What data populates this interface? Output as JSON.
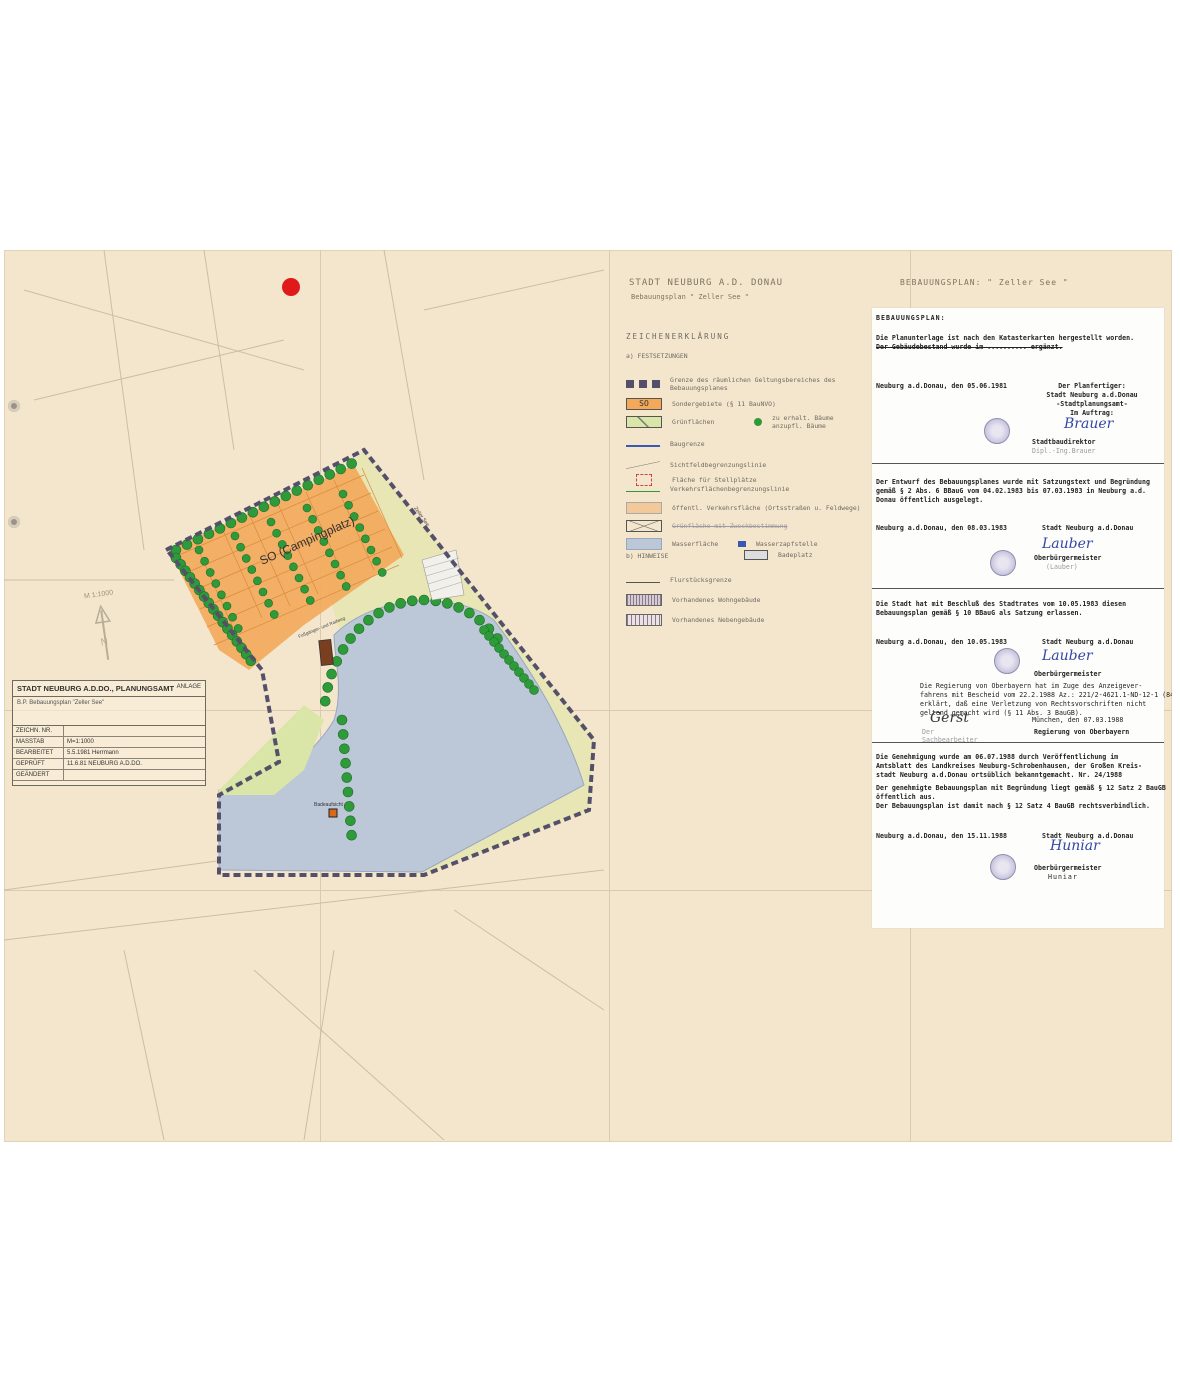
{
  "map": {
    "label_zone": "SO (Campingplatz)",
    "label_road": "Zeller See",
    "label_path": "Fußgänger- und Radweg",
    "label_bath": "Badeaufsicht",
    "label_north": "M 1:1000"
  },
  "title_block": {
    "office": "STADT NEUBURG A.D.DO., PLANUNGSAMT",
    "anlage": "ANLAGE",
    "subject": "B.P. Bebauungsplan \"Zeller See\"",
    "rows": [
      {
        "k": "ZEICHN. NR.",
        "v": ""
      },
      {
        "k": "MASSTAB",
        "v": "M=1:1000"
      },
      {
        "k": "BEARBEITET",
        "v": "5.5.1981 Herrmann"
      },
      {
        "k": "GEPRÜFT",
        "v": "11.6.81   NEUBURG A.D.DO."
      },
      {
        "k": "GEÄNDERT",
        "v": ""
      }
    ]
  },
  "header_left": "STADT   NEUBURG A.D. DONAU",
  "header_sub": "Bebauungsplan  \" Zeller See \"",
  "header_right": "BEBAUUNGSPLAN: \" Zeller See \"",
  "legend": {
    "title": "ZEICHENERKLÄRUNG",
    "section_a": "a)  FESTSETZUNGEN",
    "section_b": "b)  HINWEISE",
    "items": [
      "Grenze des räumlichen Geltungsbereiches des Bebauungsplanes",
      "Sondergebiete (§ 11 BauNVO)",
      "Grünflächen",
      "Baugrenze",
      "Sichtfeldbegrenzungslinie",
      "Fläche für Stellplätze",
      "Verkehrsflächenbegrenzungslinie",
      "öffentl. Verkehrsfläche (Ortsstraßen u. Feldwege)",
      "Wasserfläche",
      "Flurstücksgrenze",
      "Vorhandenes Wohngebäude",
      "Vorhandenes Nebengebäude"
    ],
    "trees_keep": "zu erhalt. Bäume",
    "trees_plant": "anzupfl. Bäume",
    "so_label": "SO",
    "wasserzapfstelle": "Wasserzapfstelle",
    "badeplatz": "Badeplatz"
  },
  "cert": {
    "title": "BEBAUUNGSPLAN:",
    "s1": [
      "Die Planunterlage ist nach den Katasterkarten hergestellt worden.",
      "Der Gebäudebestand wurde im .......... ergänzt."
    ],
    "s1_place": "Neuburg a.d.Donau, den 05.06.1981",
    "s1_right": [
      "Der Planfertiger:",
      "Stadt Neuburg a.d.Donau",
      "-Stadtplanungsamt-",
      "Im Auftrag:",
      "Stadtbaudirektor",
      "Dipl.-Ing.Brauer"
    ],
    "s2": [
      "Der Entwurf des Bebauungsplanes wurde mit Satzungstext und Begründung",
      "gemäß § 2 Abs. 6 BBauG vom 04.02.1983 bis 07.03.1983 in Neuburg a.d.",
      "Donau öffentlich ausgelegt."
    ],
    "s2_place": "Neuburg a.d.Donau, den 08.03.1983",
    "s2_city": "Stadt Neuburg a.d.Donau",
    "s2_right": [
      "Oberbürgermeister",
      "(Lauber)"
    ],
    "s3": [
      "Die Stadt hat mit Beschluß des Stadtrates vom 10.05.1983 diesen",
      "Bebauungsplan gemäß § 10 BBauG als Satzung erlassen."
    ],
    "s3_place": "Neuburg a.d.Donau, den 10.05.1983",
    "s3_city": "Stadt Neuburg a.d.Donau",
    "s3_right": "Oberbürgermeister",
    "s4": [
      "Die Regierung von Oberbayern hat im Zuge des Anzeigever-",
      "fahrens mit Bescheid vom 22.2.1988  Az.: 221/2-4621.1-ND-12-1 (84)",
      "erklärt, daß eine Verletzung von Rechtsvorschriften nicht",
      "geltend gemacht wird (§ 11 Abs. 3 BauGB)."
    ],
    "s4_place": "München, den 07.03.1988",
    "s4_sig_title": "Der Sachbearbeiter",
    "s4_authority": "Regierung von Oberbayern",
    "s5": [
      "Die Genehmigung wurde am 06.07.1988 durch Veröffentlichung im",
      "Amtsblatt des Landkreises Neuburg-Schrobenhausen, der Großen Kreis-",
      "stadt Neuburg a.d.Donau ortsüblich bekanntgemacht. Nr. 24/1988",
      "Der genehmigte Bebauungsplan mit Begründung liegt gemäß § 12 Satz 2 BauGB",
      "öffentlich aus.",
      "Der Bebauungsplan ist damit nach § 12 Satz 4 BauGB rechtsverbindlich."
    ],
    "s5_place": "Neuburg a.d.Donau, den 15.11.1988",
    "s5_city": "Stadt Neuburg a.d.Donau",
    "s5_right": [
      "Oberbürgermeister",
      "Huniar"
    ]
  },
  "colors": {
    "paper": "#f4e6cd",
    "orange": "#f3a85a",
    "tree": "#2e9a3a",
    "water": "#bcc7d8",
    "green_area": "#d9e6a8",
    "boundary": "#55506a",
    "ink_blue": "#3347a6",
    "red_dot": "#e01a1a"
  }
}
